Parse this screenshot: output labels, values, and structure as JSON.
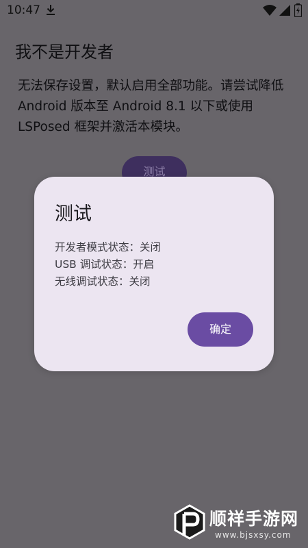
{
  "status_bar": {
    "time": "10:47",
    "icons": [
      "download-icon",
      "wifi-icon",
      "signal-icon",
      "battery-icon"
    ]
  },
  "page": {
    "title": "我不是开发者",
    "body": "无法保存设置，默认启用全部功能。请尝试降低 Android 版本至 Android 8.1 以下或使用 LSPosed 框架并激活本模块。",
    "button_label": "测试"
  },
  "dialog": {
    "title": "测试",
    "lines": [
      "开发者模式状态：关闭",
      "USB 调试状态：开启",
      "无线调试状态：关闭"
    ],
    "confirm_label": "确定"
  },
  "watermark": {
    "name": "顺祥手游网",
    "url": "www.bjsxsy.com"
  },
  "colors": {
    "scrim": "#68656a",
    "dialog_background": "#ece5f1",
    "accent": "#6a4ca3"
  }
}
